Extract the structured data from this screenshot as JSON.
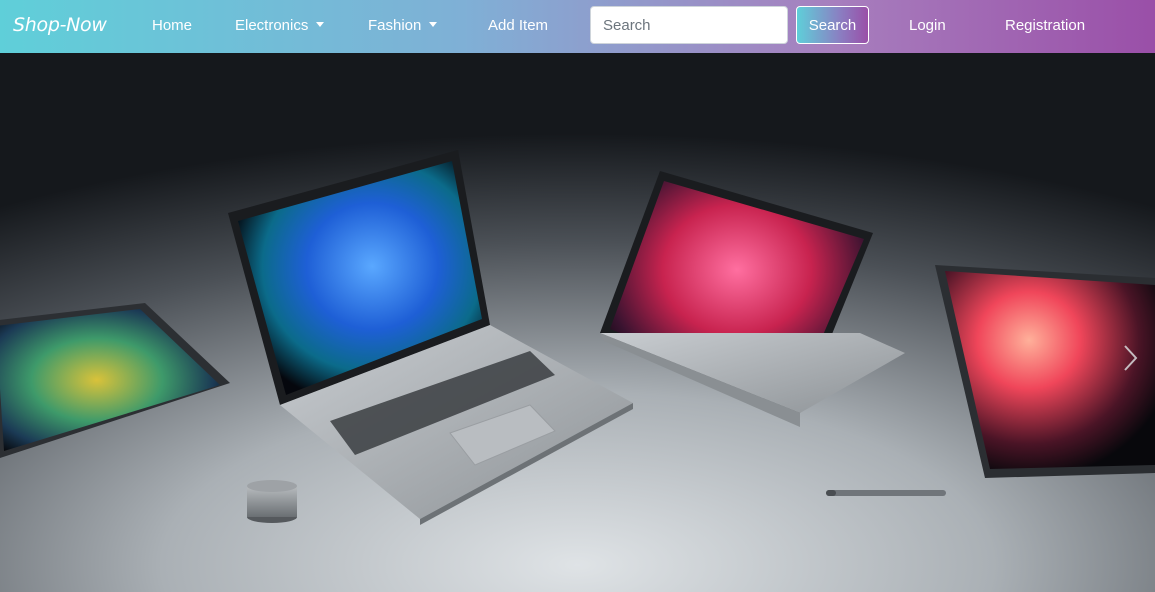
{
  "nav": {
    "brand": "Shop-Now",
    "items": {
      "home": "Home",
      "electronics": "Electronics",
      "fashion": "Fashion",
      "add_item": "Add Item",
      "login": "Login",
      "registration": "Registration"
    }
  },
  "search": {
    "placeholder": "Search",
    "button_label": "Search"
  },
  "carousel": {
    "next_icon": "chevron-right-icon"
  }
}
